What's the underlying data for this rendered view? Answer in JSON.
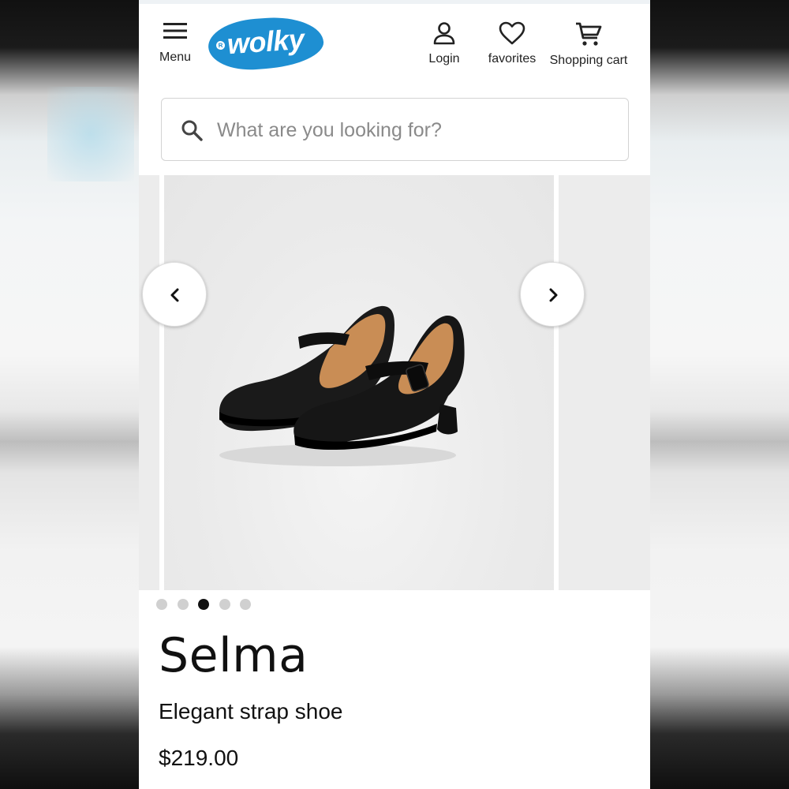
{
  "header": {
    "menu_label": "Menu",
    "logo_text": "wolky",
    "logo_mark": "R",
    "login_label": "Login",
    "favorites_label": "favorites",
    "cart_label": "Shopping cart",
    "icons": {
      "menu": "hamburger-icon",
      "login": "user-icon",
      "favorites": "heart-icon",
      "cart": "cart-icon"
    },
    "brand_color": "#1e8fd2"
  },
  "search": {
    "placeholder": "What are you looking for?",
    "value": ""
  },
  "carousel": {
    "active_index": 2,
    "count": 5
  },
  "product": {
    "name": "Selma",
    "description": "Elegant strap shoe",
    "price": "$219.00"
  }
}
